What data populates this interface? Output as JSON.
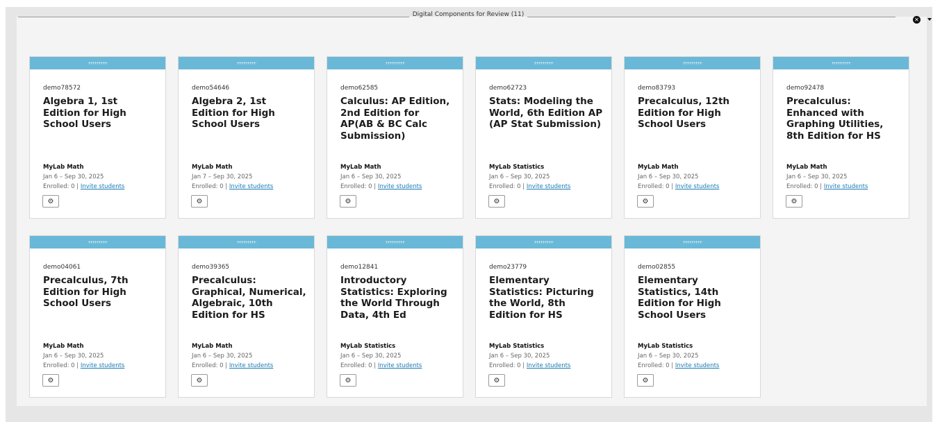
{
  "section": {
    "title": "Digital Components for Review (11)",
    "close_icon": "close-circle-icon",
    "collapse_icon": "caret-down-icon"
  },
  "colors": {
    "card_bar": "#6ab8d7",
    "link": "#1a7bb5"
  },
  "courses": [
    {
      "code": "demo78572",
      "title": "Algebra 1, 1st Edition for High School Users",
      "product": "MyLab Math",
      "dates": "Jan 6 – Sep 30, 2025",
      "enrolled": "Enrolled: 0",
      "sep": "|",
      "invite": "Invite students"
    },
    {
      "code": "demo54646",
      "title": "Algebra 2, 1st Edition for High School Users",
      "product": "MyLab Math",
      "dates": "Jan 7 – Sep 30, 2025",
      "enrolled": "Enrolled: 0",
      "sep": "|",
      "invite": "Invite students"
    },
    {
      "code": "demo62585",
      "title": "Calculus: AP Edition, 2nd Edition for AP(AB & BC Calc Submission)",
      "product": "MyLab Math",
      "dates": "Jan 6 – Sep 30, 2025",
      "enrolled": "Enrolled: 0",
      "sep": "|",
      "invite": "Invite students"
    },
    {
      "code": "demo62723",
      "title": "Stats: Modeling the World, 6th Edition AP (AP Stat Submission)",
      "product": "MyLab Statistics",
      "dates": "Jan 6 – Sep 30, 2025",
      "enrolled": "Enrolled: 0",
      "sep": "|",
      "invite": "Invite students"
    },
    {
      "code": "demo83793",
      "title": "Precalculus, 12th Edition for High School Users",
      "product": "MyLab Math",
      "dates": "Jan 6 – Sep 30, 2025",
      "enrolled": "Enrolled: 0",
      "sep": "|",
      "invite": "Invite students"
    },
    {
      "code": "demo92478",
      "title": "Precalculus: Enhanced with Graphing Utilities, 8th Edition for HS",
      "product": "MyLab Math",
      "dates": "Jan 6 – Sep 30, 2025",
      "enrolled": "Enrolled: 0",
      "sep": "|",
      "invite": "Invite students"
    },
    {
      "code": "demo04061",
      "title": "Precalculus, 7th Edition for High School Users",
      "product": "MyLab Math",
      "dates": "Jan 6 – Sep 30, 2025",
      "enrolled": "Enrolled: 0",
      "sep": "|",
      "invite": "Invite students"
    },
    {
      "code": "demo39365",
      "title": "Precalculus: Graphical, Numerical, Algebraic, 10th Edition for HS",
      "product": "MyLab Math",
      "dates": "Jan 6 – Sep 30, 2025",
      "enrolled": "Enrolled: 0",
      "sep": "|",
      "invite": "Invite students"
    },
    {
      "code": "demo12841",
      "title": "Introductory Statistics: Exploring the World Through Data, 4th Ed",
      "product": "MyLab Statistics",
      "dates": "Jan 6 – Sep 30, 2025",
      "enrolled": "Enrolled: 0",
      "sep": "|",
      "invite": "Invite students"
    },
    {
      "code": "demo23779",
      "title": "Elementary Statistics: Picturing the World, 8th Edition for HS",
      "product": "MyLab Statistics",
      "dates": "Jan 6 – Sep 30, 2025",
      "enrolled": "Enrolled: 0",
      "sep": "|",
      "invite": "Invite students"
    },
    {
      "code": "demo02855",
      "title": "Elementary Statistics, 14th Edition for High School Users",
      "product": "MyLab Statistics",
      "dates": "Jan 6 – Sep 30, 2025",
      "enrolled": "Enrolled: 0",
      "sep": "|",
      "invite": "Invite students"
    }
  ]
}
